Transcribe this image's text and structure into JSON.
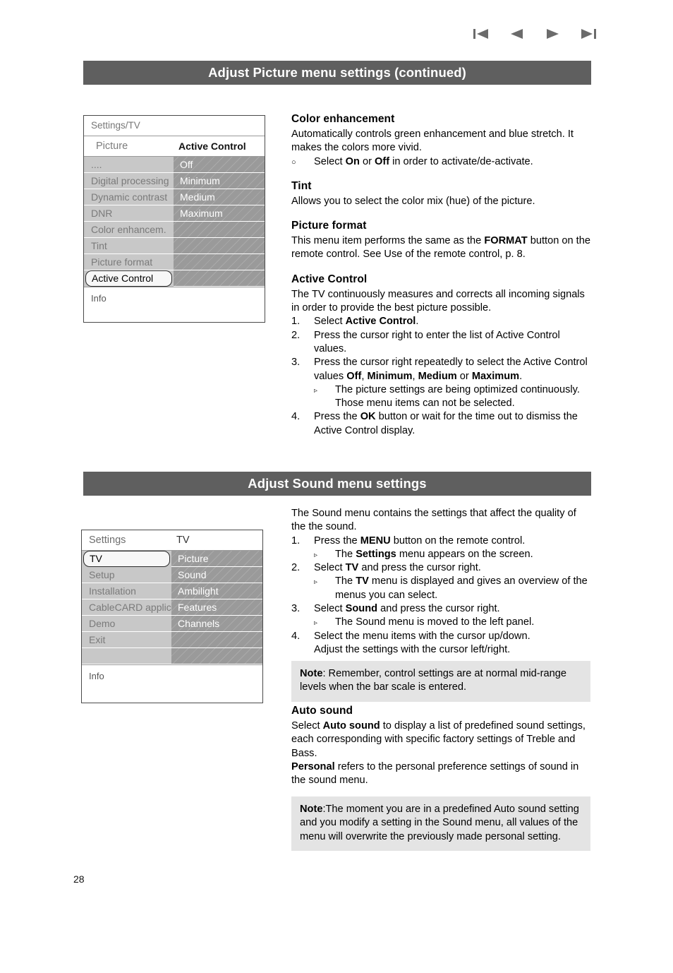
{
  "page_number": "28",
  "nav_icons": [
    {
      "name": "skip-to-first-icon",
      "label": "First"
    },
    {
      "name": "previous-page-icon",
      "label": "Previous"
    },
    {
      "name": "next-page-icon",
      "label": "Next"
    },
    {
      "name": "skip-to-last-icon",
      "label": "Last"
    }
  ],
  "banners": {
    "picture": "Adjust Picture menu settings (continued)",
    "sound": "Adjust Sound menu settings"
  },
  "osd_picture": {
    "title": "Settings/TV",
    "subhead_left": "Picture",
    "subhead_right": "Active Control",
    "left_items": [
      "....",
      "Digital processing",
      "Dynamic contrast",
      "DNR",
      "Color enhancem.",
      "Tint",
      "Picture format",
      "Active Control"
    ],
    "selected_left": "Active Control",
    "right_items": [
      "Off",
      "Minimum",
      "Medium",
      "Maximum",
      "",
      "",
      "",
      ""
    ],
    "info": "Info"
  },
  "osd_sound": {
    "title_left": "Settings",
    "title_right": "TV",
    "left_items": [
      "TV",
      "Setup",
      "Installation",
      "CableCARD applic.",
      "Demo",
      "Exit",
      ""
    ],
    "selected_left": "TV",
    "right_items": [
      "Picture",
      "Sound",
      "Ambilight",
      "Features",
      "Channels",
      "",
      ""
    ],
    "info": "Info"
  },
  "picture_section": {
    "color_enhancement": {
      "heading": "Color enhancement",
      "body": "Automatically controls green enhancement and blue stretch. It makes the colors more vivid.",
      "bullet_marker": "○",
      "bullet_pre": "Select ",
      "bullet_b1": "On",
      "bullet_mid": " or ",
      "bullet_b2": "Off",
      "bullet_post": " in order to activate/de-activate."
    },
    "tint": {
      "heading": "Tint",
      "body": "Allows you to select the color mix (hue) of the picture."
    },
    "picture_format": {
      "heading": "Picture format",
      "pre": "This menu item performs the same as the ",
      "bold": "FORMAT",
      "post": " button on the remote control. See Use of the remote control, p. 8."
    },
    "active_control": {
      "heading": "Active Control",
      "body": "The TV continuously measures and corrects all incoming signals in order to provide the best picture possible.",
      "steps": [
        {
          "num": "1.",
          "pre": "Select ",
          "bold": "Active Control",
          "post": "."
        },
        {
          "num": "2.",
          "pre": "Press the cursor right to enter the list of Active Control values.",
          "bold": "",
          "post": ""
        },
        {
          "num": "3.",
          "pre": "Press the cursor right repeatedly to select the Active Control values ",
          "bold": "Off",
          "post": ", ",
          "bold2": "Minimum",
          "post2": ", ",
          "bold3": "Medium",
          "post3": " or ",
          "bold4": "Maximum",
          "post4": "."
        },
        {
          "num": "4.",
          "pre": "Press the ",
          "bold": "OK",
          "post": " button or wait for the time out to dismiss the Active Control display."
        }
      ],
      "sub_marker": "▹",
      "sub_note": "The picture settings are being optimized continuously. Those menu items can not be selected."
    }
  },
  "sound_section": {
    "intro": "The Sound menu contains the settings that affect the quality of the the sound.",
    "steps": [
      {
        "num": "1.",
        "pre": "Press the ",
        "bold": "MENU",
        "post": " button on the remote control."
      },
      {
        "num": "2.",
        "pre": "Select ",
        "bold": "TV",
        "post": " and press the cursor right."
      },
      {
        "num": "3.",
        "pre": "Select ",
        "bold": "Sound",
        "post": " and press the cursor right."
      },
      {
        "num": "4.",
        "pre": "Select the menu items with the cursor up/down.",
        "bold": "",
        "post": ""
      }
    ],
    "step4_line2": "Adjust the settings with the cursor left/right.",
    "sub_marker": "▹",
    "sub_1_pre": "The ",
    "sub_1_bold": "Settings",
    "sub_1_post": " menu appears on the screen.",
    "sub_2_pre": "The ",
    "sub_2_bold": "TV",
    "sub_2_post": " menu is displayed and gives an overview of the menus you can select.",
    "sub_3": "The Sound menu is moved to the left panel.",
    "note_1_bold": "Note",
    "note_1_text": ": Remember, control settings are at normal mid-range levels when the bar scale is entered.",
    "auto_sound": {
      "heading": "Auto sound",
      "pre": "Select ",
      "bold": "Auto sound",
      "post": " to display a list of predefined sound settings, each corresponding with specific factory settings of Treble and Bass.",
      "personal_bold": "Personal",
      "personal_post": " refers to the personal preference settings of sound in the sound menu."
    },
    "note_2_bold": "Note",
    "note_2_text": ":The moment you are in a predefined Auto sound setting and you modify a setting in the Sound menu, all values of the menu will overwrite the previously made personal setting."
  }
}
